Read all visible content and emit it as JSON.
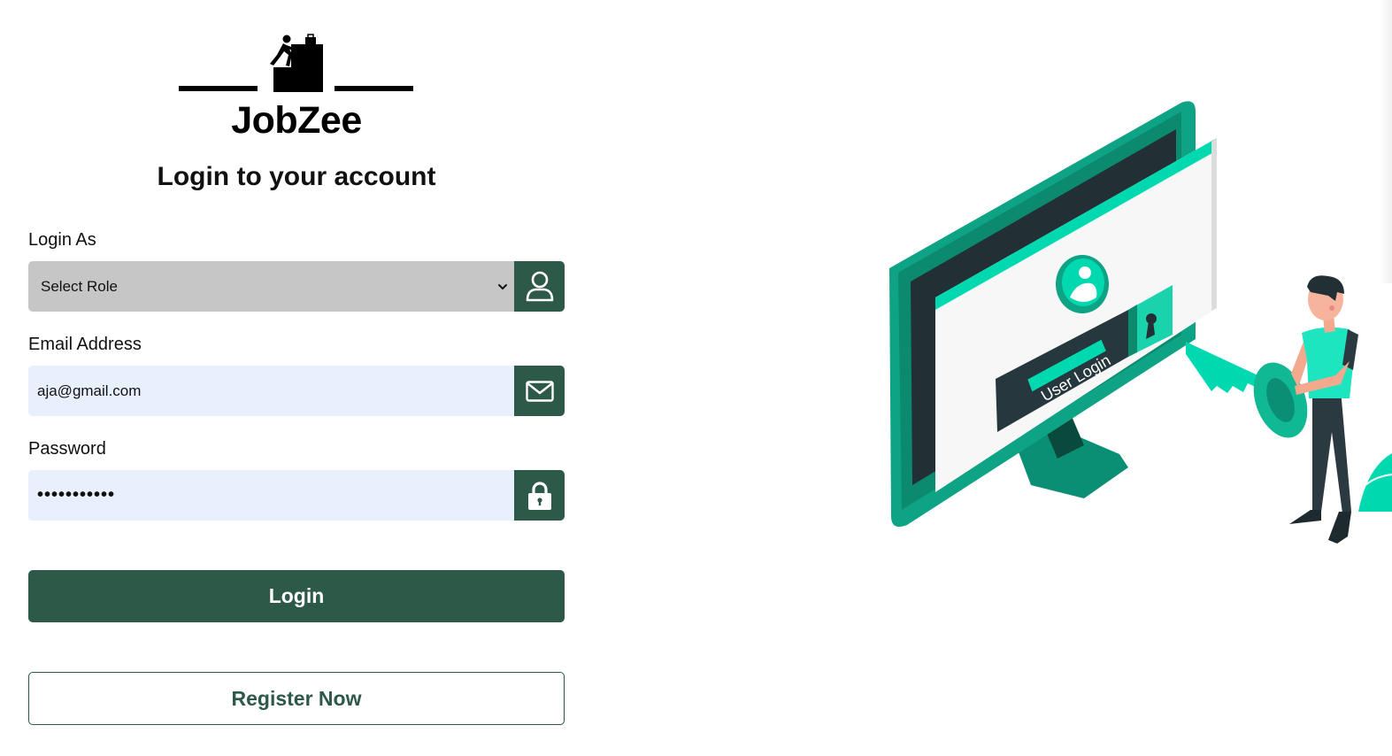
{
  "brand": {
    "name": "JobZee"
  },
  "page": {
    "title": "Login to your account"
  },
  "form": {
    "role": {
      "label": "Login As",
      "selected": "Select Role",
      "options": [
        "Select Role"
      ]
    },
    "email": {
      "label": "Email Address",
      "value": "aja@gmail.com",
      "type": "email"
    },
    "password": {
      "label": "Password",
      "value": "•••••••••••",
      "type": "password"
    }
  },
  "buttons": {
    "login": "Login",
    "register": "Register Now"
  },
  "illustration": {
    "badge_text": "User Login"
  },
  "icons": {
    "role": "user-icon",
    "email": "envelope-icon",
    "password": "lock-icon",
    "select": "chevron-down-icon"
  },
  "colors": {
    "primary": "#2d5949",
    "accent": "#00d9b0",
    "select_bg": "#c6c6c6",
    "input_bg": "#e8f0fe"
  }
}
